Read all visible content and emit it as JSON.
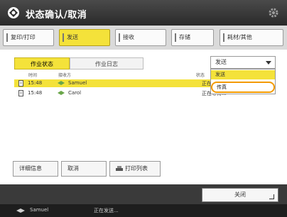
{
  "title": "状态确认/取消",
  "tabs": [
    "复印/打印",
    "发送",
    "接收",
    "存储",
    "耗材/其他"
  ],
  "subtabs": [
    "作业状态",
    "作业日志"
  ],
  "dropdown": {
    "value": "发送",
    "options": [
      "发送",
      "传真"
    ]
  },
  "table": {
    "headers": [
      "时间",
      "接收方",
      "状态"
    ],
    "rows": [
      {
        "time": "15:48",
        "dest": "Samuel",
        "status": "正在发送"
      },
      {
        "time": "15:48",
        "dest": "Carol",
        "status": "正在等待..."
      }
    ]
  },
  "buttons": {
    "details": "详细信息",
    "cancel": "取消",
    "print_list": "打印列表"
  },
  "close_label": "关闭",
  "statusbar": {
    "dest": "Samuel",
    "status": "正在发送..."
  },
  "colors": {
    "accent": "#f4e23a",
    "highlight": "#f39a00"
  }
}
